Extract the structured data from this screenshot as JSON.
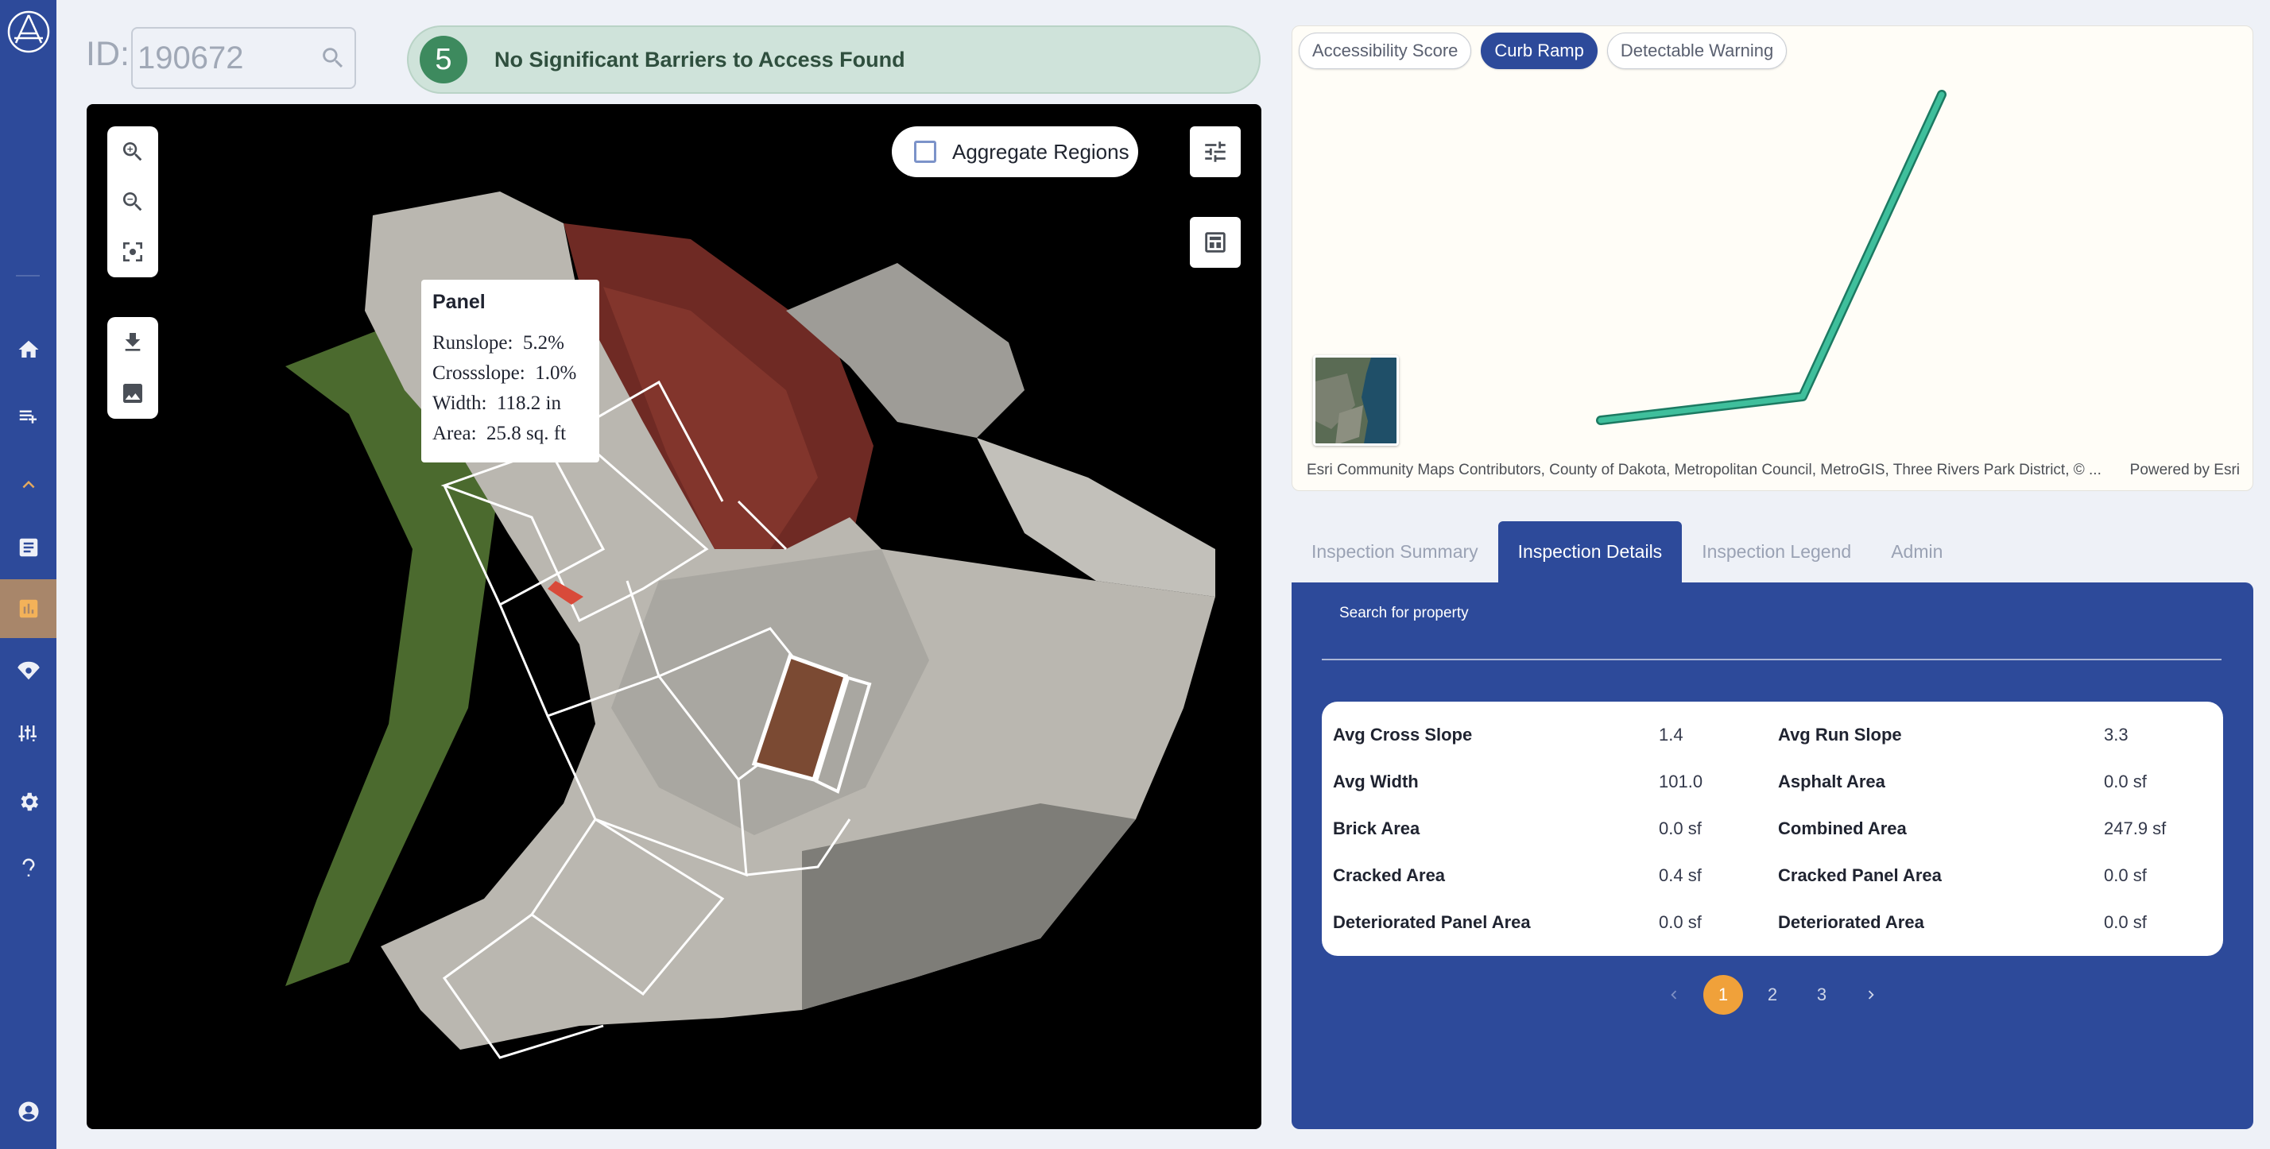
{
  "sidebar": {
    "items": [
      {
        "name": "home-icon"
      },
      {
        "name": "playlist-icon"
      },
      {
        "name": "chevron-up-icon"
      },
      {
        "name": "document-icon"
      },
      {
        "name": "bar-chart-icon",
        "active": true
      },
      {
        "name": "signal-icon"
      },
      {
        "name": "tune-icon"
      },
      {
        "name": "settings-icon"
      },
      {
        "name": "help-icon"
      },
      {
        "name": "account-icon"
      }
    ],
    "accent_active": "#f3b259",
    "bg": "#2d4a9a"
  },
  "header": {
    "id_label": "ID:",
    "id_value": "190672",
    "status_score": "5",
    "status_text": "No Significant Barriers to Access Found",
    "status_color": "#3d8a5e"
  },
  "viewer": {
    "aggregate_label": "Aggregate Regions",
    "aggregate_checked": false,
    "popup": {
      "title": "Panel",
      "rows": [
        {
          "label": "Runslope:",
          "value": "5.2%"
        },
        {
          "label": "Crossslope:",
          "value": "1.0%"
        },
        {
          "label": "Width:",
          "value": "118.2 in"
        },
        {
          "label": "Area:",
          "value": "25.8 sq. ft"
        }
      ]
    },
    "tools": [
      "zoom-in-icon",
      "zoom-out-icon",
      "fit-view-icon",
      "download-icon",
      "image-icon",
      "filter-settings-icon",
      "layers-icon"
    ]
  },
  "minimap": {
    "pills": [
      {
        "label": "Accessibility Score",
        "active": false
      },
      {
        "label": "Curb Ramp",
        "active": true
      },
      {
        "label": "Detectable Warning",
        "active": false
      }
    ],
    "attribution": "Esri Community Maps Contributors, County of Dakota, Metropolitan Council, MetroGIS, Three Rivers Park District, © ...",
    "powered_by": "Powered by Esri",
    "trace_color": "#3fbf9c"
  },
  "tabs": [
    {
      "label": "Inspection Summary",
      "active": false
    },
    {
      "label": "Inspection Details",
      "active": true
    },
    {
      "label": "Inspection Legend",
      "active": false
    },
    {
      "label": "Admin",
      "active": false
    }
  ],
  "details": {
    "search_label": "Search for property",
    "search_value": "",
    "properties": [
      {
        "key": "Avg Cross Slope",
        "value": "1.4"
      },
      {
        "key": "Avg Run Slope",
        "value": "3.3"
      },
      {
        "key": "Avg Width",
        "value": "101.0"
      },
      {
        "key": "Asphalt Area",
        "value": "0.0 sf"
      },
      {
        "key": "Brick Area",
        "value": "0.0 sf"
      },
      {
        "key": "Combined Area",
        "value": "247.9 sf"
      },
      {
        "key": "Cracked Area",
        "value": "0.4 sf"
      },
      {
        "key": "Cracked Panel Area",
        "value": "0.0 sf"
      },
      {
        "key": "Deteriorated Panel Area",
        "value": "0.0 sf"
      },
      {
        "key": "Deteriorated Area",
        "value": "0.0 sf"
      }
    ],
    "pagination": {
      "pages": [
        "1",
        "2",
        "3"
      ],
      "current": "1"
    }
  }
}
